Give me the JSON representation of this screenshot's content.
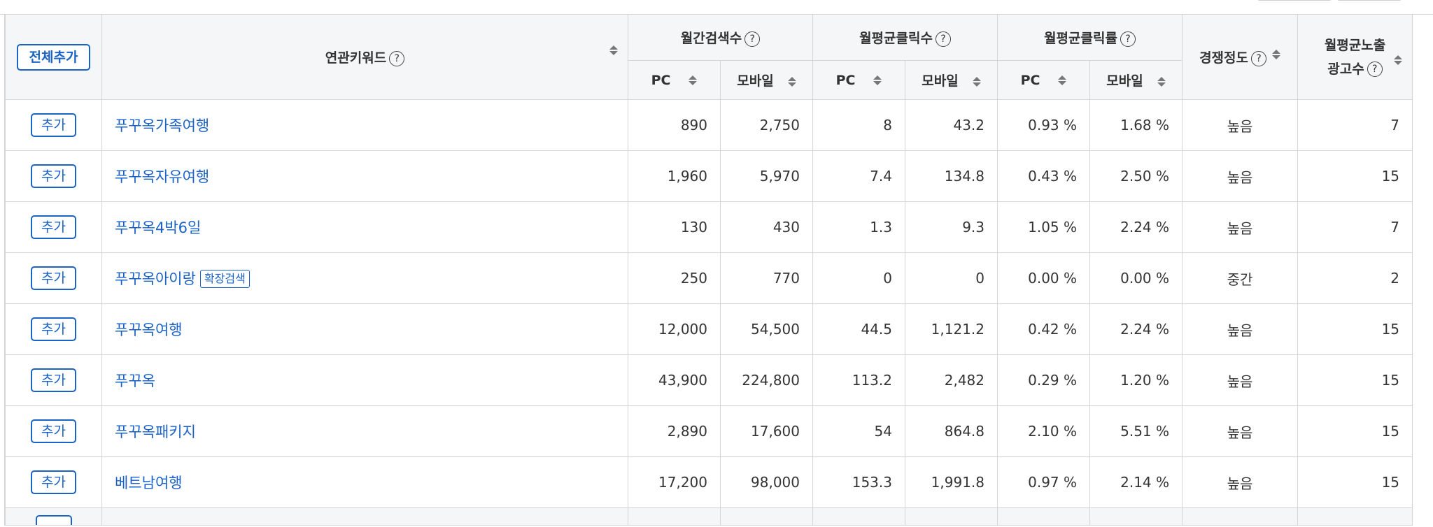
{
  "header": {
    "add_all_label": "전체추가",
    "keyword_col": "연관키워드",
    "groups": [
      {
        "label": "월간검색수"
      },
      {
        "label": "월평균클릭수"
      },
      {
        "label": "월평균클릭률"
      }
    ],
    "sub_pc": "PC",
    "sub_mobile": "모바일",
    "competition_col": "경쟁정도",
    "ads_col_line1": "월평균노출",
    "ads_col_line2": "광고수",
    "help_glyph": "?"
  },
  "row_add_label": "추가",
  "rows": [
    {
      "keyword": "푸꾸옥가족여행",
      "badge": "",
      "search_pc": "890",
      "search_mobile": "2,750",
      "click_pc": "8",
      "click_mobile": "43.2",
      "ctr_pc": "0.93 %",
      "ctr_mobile": "1.68 %",
      "competition": "높음",
      "ads": "7"
    },
    {
      "keyword": "푸꾸옥자유여행",
      "badge": "",
      "search_pc": "1,960",
      "search_mobile": "5,970",
      "click_pc": "7.4",
      "click_mobile": "134.8",
      "ctr_pc": "0.43 %",
      "ctr_mobile": "2.50 %",
      "competition": "높음",
      "ads": "15"
    },
    {
      "keyword": "푸꾸옥4박6일",
      "badge": "",
      "search_pc": "130",
      "search_mobile": "430",
      "click_pc": "1.3",
      "click_mobile": "9.3",
      "ctr_pc": "1.05 %",
      "ctr_mobile": "2.24 %",
      "competition": "높음",
      "ads": "7"
    },
    {
      "keyword": "푸꾸옥아이랑",
      "badge": "확장검색",
      "search_pc": "250",
      "search_mobile": "770",
      "click_pc": "0",
      "click_mobile": "0",
      "ctr_pc": "0.00 %",
      "ctr_mobile": "0.00 %",
      "competition": "중간",
      "ads": "2"
    },
    {
      "keyword": "푸꾸옥여행",
      "badge": "",
      "search_pc": "12,000",
      "search_mobile": "54,500",
      "click_pc": "44.5",
      "click_mobile": "1,121.2",
      "ctr_pc": "0.42 %",
      "ctr_mobile": "2.24 %",
      "competition": "높음",
      "ads": "15"
    },
    {
      "keyword": "푸꾸옥",
      "badge": "",
      "search_pc": "43,900",
      "search_mobile": "224,800",
      "click_pc": "113.2",
      "click_mobile": "2,482",
      "ctr_pc": "0.29 %",
      "ctr_mobile": "1.20 %",
      "competition": "높음",
      "ads": "15"
    },
    {
      "keyword": "푸꾸옥패키지",
      "badge": "",
      "search_pc": "2,890",
      "search_mobile": "17,600",
      "click_pc": "54",
      "click_mobile": "864.8",
      "ctr_pc": "2.10 %",
      "ctr_mobile": "5.51 %",
      "competition": "높음",
      "ads": "15"
    },
    {
      "keyword": "베트남여행",
      "badge": "",
      "search_pc": "17,200",
      "search_mobile": "98,000",
      "click_pc": "153.3",
      "click_mobile": "1,991.8",
      "ctr_pc": "0.97 %",
      "ctr_mobile": "2.14 %",
      "competition": "높음",
      "ads": "15"
    }
  ]
}
